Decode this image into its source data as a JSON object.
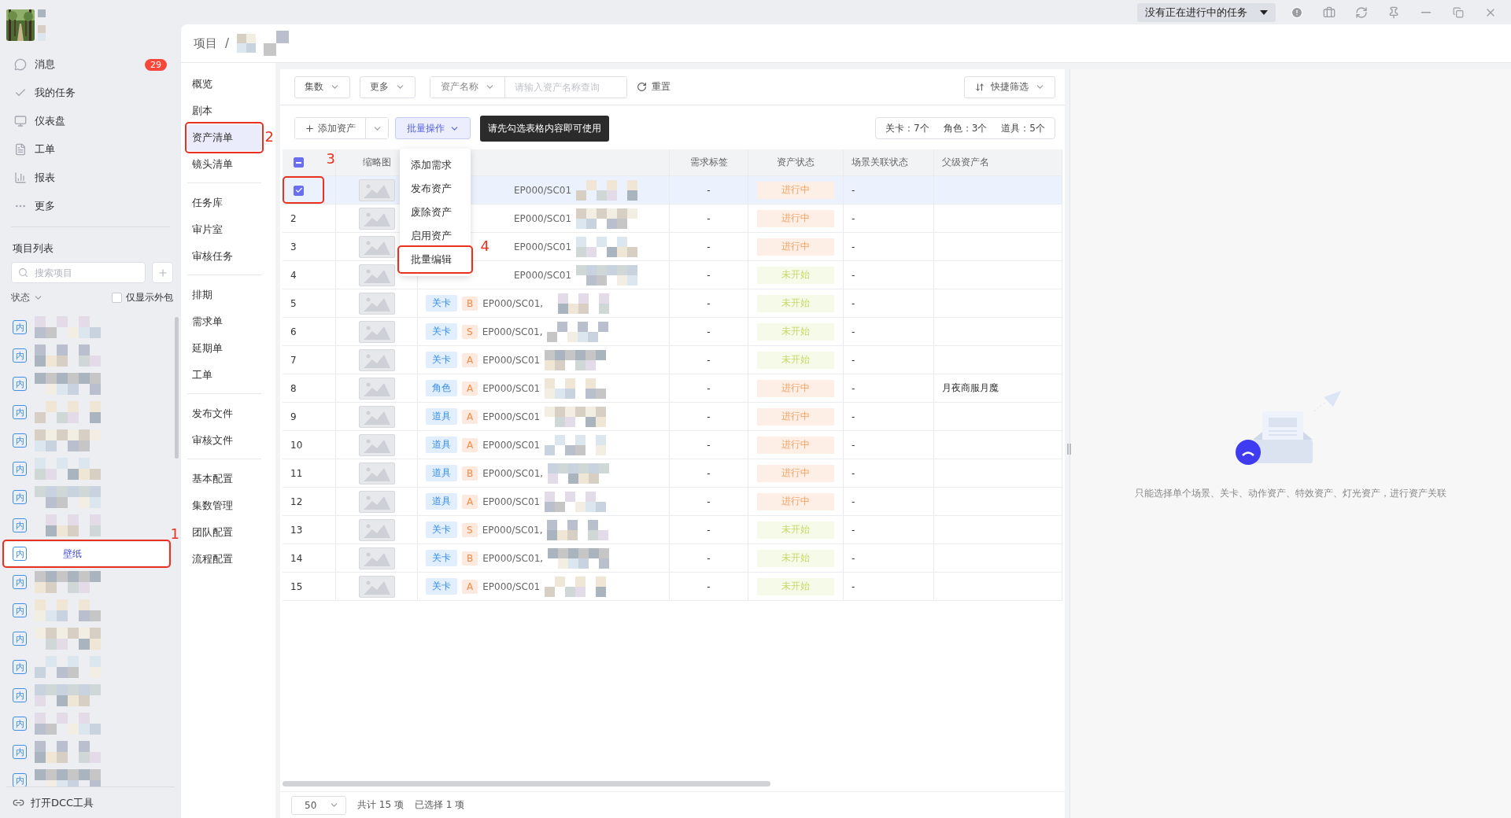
{
  "top_bar": {
    "task_status": "没有正在进行中的任务"
  },
  "sidebar": {
    "nav": [
      {
        "kind": "message",
        "label": "消息",
        "badge": "29"
      },
      {
        "kind": "task",
        "label": "我的任务"
      },
      {
        "kind": "dashboard",
        "label": "仪表盘"
      },
      {
        "kind": "ticket",
        "label": "工单"
      },
      {
        "kind": "report",
        "label": "报表"
      },
      {
        "kind": "more",
        "label": "更多"
      }
    ],
    "project_list": {
      "title": "项目列表",
      "search": {
        "placeholder": "搜索项目"
      },
      "status_filter": "状态",
      "outsource_only": {
        "label": "仅显示外包",
        "checked": false
      },
      "projects": [
        {
          "badge": "内",
          "redacted": true,
          "selected": false
        },
        {
          "badge": "内",
          "redacted": true,
          "selected": false
        },
        {
          "badge": "内",
          "redacted": true,
          "selected": false
        },
        {
          "badge": "内",
          "redacted": true,
          "selected": false
        },
        {
          "badge": "内",
          "redacted": true,
          "selected": false
        },
        {
          "badge": "内",
          "redacted": true,
          "selected": false
        },
        {
          "badge": "内",
          "redacted": true,
          "selected": false
        },
        {
          "badge": "内",
          "redacted": true,
          "selected": false
        },
        {
          "badge": "内",
          "name": "壁纸",
          "selected": true,
          "annotation": "1"
        },
        {
          "badge": "内",
          "redacted": true,
          "selected": false
        },
        {
          "badge": "内",
          "redacted": true,
          "selected": false
        },
        {
          "badge": "内",
          "redacted": true,
          "selected": false
        },
        {
          "badge": "内",
          "redacted": true,
          "selected": false
        },
        {
          "badge": "内",
          "redacted": true,
          "selected": false
        },
        {
          "badge": "内",
          "redacted": true,
          "selected": false
        },
        {
          "badge": "内",
          "redacted": true,
          "selected": false
        },
        {
          "badge": "内",
          "redacted": true,
          "selected": false
        }
      ]
    },
    "footer": "打开DCC工具"
  },
  "breadcrumb": {
    "root": "项目",
    "separator": "/"
  },
  "nav": {
    "groups": [
      {
        "items": [
          {
            "label": "概览",
            "selected": false
          },
          {
            "label": "剧本",
            "selected": false
          },
          {
            "label": "资产清单",
            "selected": true,
            "annotation": "2"
          },
          {
            "label": "镜头清单",
            "selected": false
          }
        ]
      },
      {
        "items": [
          {
            "label": "任务库",
            "selected": false
          },
          {
            "label": "审片室",
            "selected": false
          },
          {
            "label": "审核任务",
            "selected": false
          }
        ]
      },
      {
        "items": [
          {
            "label": "排期",
            "selected": false
          },
          {
            "label": "需求单",
            "selected": false
          },
          {
            "label": "延期单",
            "selected": false
          },
          {
            "label": "工单",
            "selected": false
          }
        ]
      },
      {
        "items": [
          {
            "label": "发布文件",
            "selected": false
          },
          {
            "label": "审核文件",
            "selected": false
          }
        ]
      },
      {
        "items": [
          {
            "label": "基本配置",
            "selected": false
          },
          {
            "label": "集数管理",
            "selected": false
          },
          {
            "label": "团队配置",
            "selected": false
          },
          {
            "label": "流程配置",
            "selected": false
          }
        ]
      }
    ]
  },
  "toolbar": {
    "filters": [
      "集数",
      "更多"
    ],
    "search": {
      "field": "资产名称",
      "placeholder": "请输入资产名称查询"
    },
    "reset": "重置",
    "quick_filter": "快捷筛选"
  },
  "actions": {
    "add": "添加资产",
    "batch": "批量操作",
    "tooltip": "请先勾选表格内容即可使用",
    "counts": [
      "关卡：7个",
      "角色：3个",
      "道具：5个"
    ]
  },
  "batch_menu": [
    {
      "label": "添加需求"
    },
    {
      "label": "发布资产"
    },
    {
      "label": "废除资产"
    },
    {
      "label": "启用资产"
    },
    {
      "label": "批量编辑",
      "annotation": "4"
    }
  ],
  "table": {
    "header_checkbox": {
      "indeterminate": true
    },
    "columns": [
      "缩略图",
      "需求标签",
      "资产状态",
      "场景关联状态",
      "父级资产名"
    ],
    "rows": [
      {
        "selected": true,
        "annotation": "3",
        "code": "EP000/SC01",
        "demand_tag": "-",
        "status": {
          "label": "进行中",
          "kind": "in_progress"
        },
        "scene_link": "-"
      },
      {
        "index": "2",
        "selected": false,
        "code": "EP000/SC01",
        "demand_tag": "-",
        "status": {
          "label": "进行中",
          "kind": "in_progress"
        },
        "scene_link": "-"
      },
      {
        "index": "3",
        "selected": false,
        "code": "EP000/SC01",
        "demand_tag": "-",
        "status": {
          "label": "进行中",
          "kind": "in_progress"
        },
        "scene_link": "-"
      },
      {
        "index": "4",
        "selected": false,
        "code": "EP000/SC01",
        "demand_tag": "-",
        "status": {
          "label": "未开始",
          "kind": "not_started"
        },
        "scene_link": "-"
      },
      {
        "index": "5",
        "selected": false,
        "type": "关卡",
        "grade": "B",
        "code": "EP000/SC01,",
        "demand_tag": "-",
        "status": {
          "label": "未开始",
          "kind": "not_started"
        },
        "scene_link": "-"
      },
      {
        "index": "6",
        "selected": false,
        "type": "关卡",
        "grade": "S",
        "code": "EP000/SC01,",
        "demand_tag": "-",
        "status": {
          "label": "未开始",
          "kind": "not_started"
        },
        "scene_link": "-"
      },
      {
        "index": "7",
        "selected": false,
        "type": "关卡",
        "grade": "A",
        "code": "EP000/SC01",
        "demand_tag": "-",
        "status": {
          "label": "未开始",
          "kind": "not_started"
        },
        "scene_link": "-"
      },
      {
        "index": "8",
        "selected": false,
        "type": "角色",
        "grade": "A",
        "code": "EP000/SC01",
        "demand_tag": "-",
        "status": {
          "label": "进行中",
          "kind": "in_progress"
        },
        "scene_link": "-",
        "parent": "月夜商服月魔"
      },
      {
        "index": "9",
        "selected": false,
        "type": "道具",
        "grade": "A",
        "code": "EP000/SC01",
        "demand_tag": "-",
        "status": {
          "label": "进行中",
          "kind": "in_progress"
        },
        "scene_link": "-"
      },
      {
        "index": "10",
        "selected": false,
        "type": "道具",
        "grade": "A",
        "code": "EP000/SC01",
        "demand_tag": "-",
        "status": {
          "label": "进行中",
          "kind": "in_progress"
        },
        "scene_link": "-"
      },
      {
        "index": "11",
        "selected": false,
        "type": "道具",
        "grade": "B",
        "code": "EP000/SC01,",
        "demand_tag": "-",
        "status": {
          "label": "进行中",
          "kind": "in_progress"
        },
        "scene_link": "-"
      },
      {
        "index": "12",
        "selected": false,
        "type": "道具",
        "grade": "A",
        "code": "EP000/SC01",
        "demand_tag": "-",
        "status": {
          "label": "进行中",
          "kind": "in_progress"
        },
        "scene_link": "-"
      },
      {
        "index": "13",
        "selected": false,
        "type": "关卡",
        "grade": "S",
        "code": "EP000/SC01,",
        "demand_tag": "-",
        "status": {
          "label": "未开始",
          "kind": "not_started"
        },
        "scene_link": "-"
      },
      {
        "index": "14",
        "selected": false,
        "type": "关卡",
        "grade": "B",
        "code": "EP000/SC01,",
        "demand_tag": "-",
        "status": {
          "label": "未开始",
          "kind": "not_started"
        },
        "scene_link": "-"
      },
      {
        "index": "15",
        "selected": false,
        "type": "关卡",
        "grade": "A",
        "code": "EP000/SC01",
        "demand_tag": "-",
        "status": {
          "label": "未开始",
          "kind": "not_started"
        },
        "scene_link": "-"
      }
    ]
  },
  "footer": {
    "page_size": "50",
    "total": "共计 15 项",
    "selected": "已选择 1 项"
  },
  "association_panel": {
    "empty_text": "只能选择单个场景、关卡、动作资产、特效资产、灯光资产，进行资产关联"
  }
}
